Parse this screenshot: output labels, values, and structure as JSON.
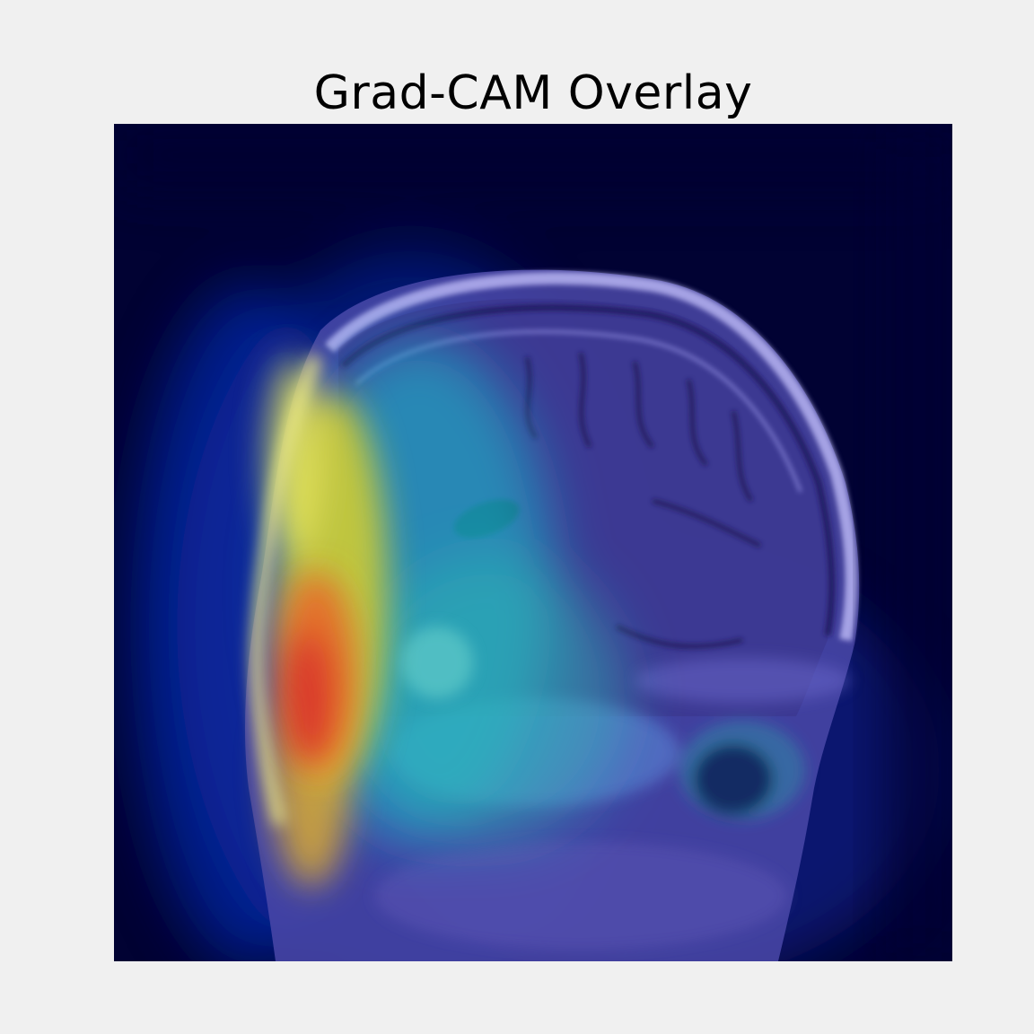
{
  "figure": {
    "title": "Grad-CAM Overlay",
    "background_color": "#f0f0f0"
  },
  "image": {
    "subject": "sagittal head MRI slice with Grad-CAM heatmap overlay",
    "colormap": "jet",
    "background_color": "#010233"
  }
}
